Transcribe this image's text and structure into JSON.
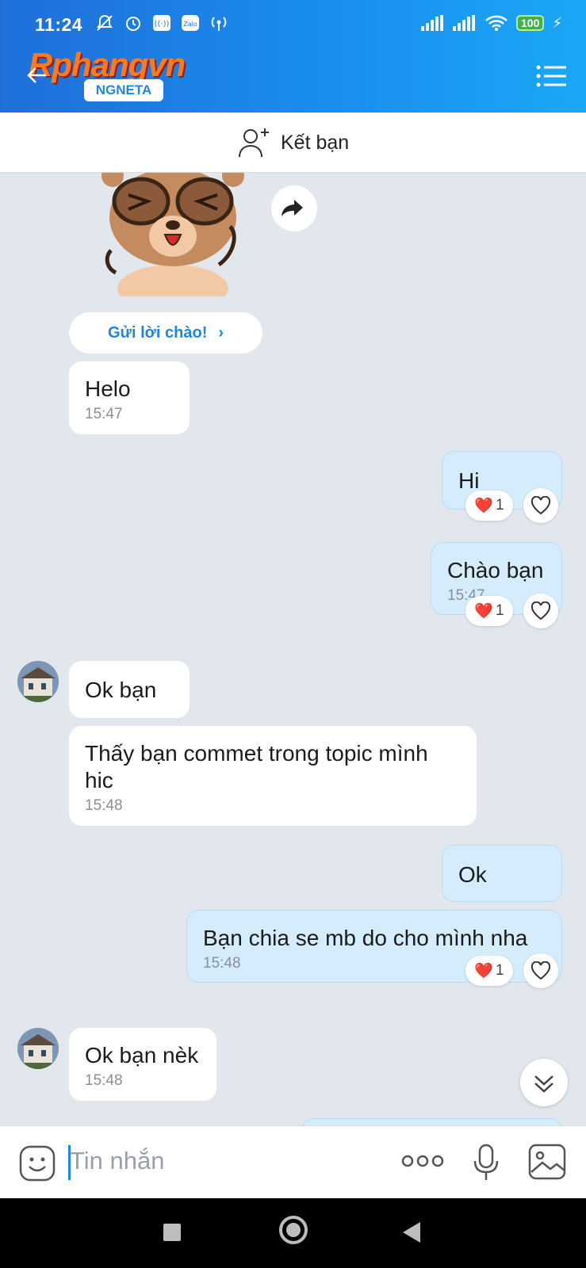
{
  "status_bar": {
    "time": "11:24",
    "battery": "100",
    "left_icons": [
      "bell-off-icon",
      "alarm-icon",
      "hotspot-icon",
      "zalo-icon",
      "wireless-icon"
    ],
    "right_icons": [
      "signal-icon",
      "signal-icon",
      "wifi-icon",
      "battery-icon",
      "charging-icon"
    ]
  },
  "header": {
    "logo_text": "Rphangvn",
    "logo_badge": "NGNETA",
    "back_icon": "back-arrow-icon",
    "menu_icon": "list-menu-icon"
  },
  "add_friend": {
    "label": "Kết bạn",
    "icon": "add-user-icon"
  },
  "greeting_button": {
    "label": "Gửi lời chào!",
    "chevron": "›"
  },
  "messages": [
    {
      "side": "in",
      "text": "Helo",
      "time": "15:47"
    },
    {
      "side": "out",
      "text": "Hi",
      "time": "",
      "reaction": {
        "emoji": "❤️",
        "count": "1"
      }
    },
    {
      "side": "out",
      "text": "Chào bạn",
      "time": "15:47",
      "reaction": {
        "emoji": "❤️",
        "count": "1"
      }
    },
    {
      "side": "in",
      "text": "Ok bạn",
      "time": ""
    },
    {
      "side": "in",
      "text": "Thấy bạn commet trong topic mình hic",
      "time": "15:48"
    },
    {
      "side": "out",
      "text": "Ok",
      "time": ""
    },
    {
      "side": "out",
      "text": "Bạn chia se mb do cho mình nha",
      "time": "15:48",
      "reaction": {
        "emoji": "❤️",
        "count": "1"
      }
    },
    {
      "side": "in",
      "text": "Ok bạn nèk",
      "time": "15:48"
    }
  ],
  "input": {
    "placeholder": "Tin nhắn"
  },
  "colors": {
    "header": "#1a8df0",
    "accent": "#1d87e6",
    "chat_bg": "#e2e7ee",
    "outgoing_bubble": "#d5ecfc",
    "incoming_bubble": "#ffffff"
  }
}
